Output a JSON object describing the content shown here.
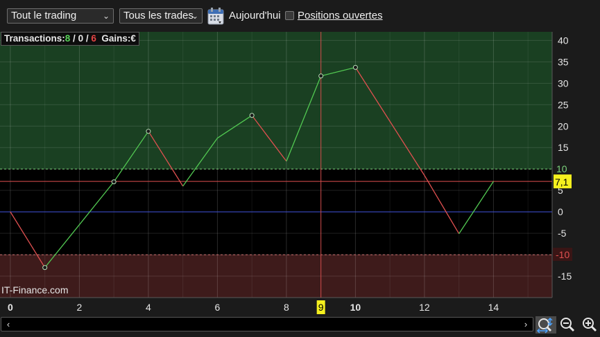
{
  "toolbar": {
    "scope_select": "Tout le trading",
    "trades_select": "Tous les trades",
    "today_label": "Aujourd'hui",
    "open_positions_label": "Positions ouvertes",
    "open_positions_checked": false
  },
  "stats": {
    "transactions_label": "Transactions:",
    "wins": "8",
    "sep1": " / ",
    "neutral": "0",
    "sep2": " / ",
    "losses": "6",
    "gains_label": "Gains:",
    "gains_value": "€"
  },
  "chart_data": {
    "type": "line",
    "x": [
      0,
      1,
      3,
      4,
      5,
      6,
      7,
      8,
      9,
      10,
      12,
      13,
      14
    ],
    "y": [
      0,
      -13,
      7,
      18.8,
      6,
      17.2,
      22.5,
      11.8,
      31.7,
      33.7,
      8.5,
      -5.1,
      7.1
    ],
    "markers_at": [
      1,
      3,
      4,
      7,
      9,
      10
    ],
    "xlim": [
      -0.3,
      15.7
    ],
    "ylim": [
      -20,
      42
    ],
    "x_ticks": [
      "0",
      "2",
      "4",
      "6",
      "8",
      "10",
      "12",
      "14"
    ],
    "x_ticks_values": [
      0,
      2,
      4,
      6,
      8,
      10,
      12,
      14
    ],
    "x_bold_ticks": [
      "0",
      "10"
    ],
    "y_ticks": [
      "-15",
      "-5",
      "0",
      "5",
      "15",
      "20",
      "25",
      "30",
      "35",
      "40"
    ],
    "y_ticks_values": [
      -15,
      -5,
      0,
      5,
      15,
      20,
      25,
      30,
      35,
      40
    ],
    "upper_threshold": 10,
    "upper_threshold_label": "10",
    "lower_threshold": -10,
    "lower_threshold_label": "-10",
    "current_value": 7.1,
    "current_value_label": "7,1",
    "cursor_x": 9,
    "cursor_x_label": "9",
    "watermark": "IT-Finance.com",
    "colors": {
      "up": "#52c952",
      "down": "#e05050",
      "zero_line": "#3d4fd8",
      "upper_zone": "#1a4022",
      "lower_zone": "#3e1b1b",
      "current_line": "#e05050",
      "cursor": "#d04a4a",
      "label_bg": "#f5f01e"
    }
  }
}
